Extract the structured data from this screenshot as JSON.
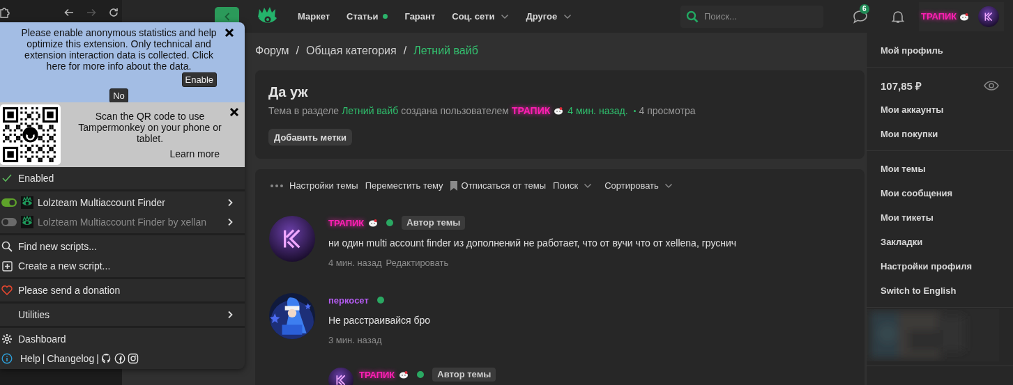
{
  "browser_toolbar": {
    "buttons": [
      {
        "kind": "extensions",
        "disabled": false
      },
      {
        "kind": "back",
        "disabled": false
      },
      {
        "kind": "forward",
        "disabled": true
      },
      {
        "kind": "reload",
        "disabled": false
      }
    ]
  },
  "tampermonkey": {
    "notice": {
      "text": "Please enable anonymous statistics and help optimize this extension. Only technical and extension interaction data is collected. Click here for more info about the data.",
      "enable_button": "Enable",
      "no_button": "No"
    },
    "qr": {
      "text": "Scan the QR code to use Tampermonkey on your phone or tablet.",
      "link": "Learn more"
    },
    "enabled": {
      "label": "Enabled",
      "checked": true
    },
    "scripts": [
      {
        "name": "Lolzteam Multiaccount Finder",
        "on": true
      },
      {
        "name": "Lolzteam Multiaccount Finder by xellan",
        "on": false
      }
    ],
    "menu_groups": [
      {
        "items": [
          {
            "kind": "find",
            "label": "Find new scripts..."
          },
          {
            "kind": "create",
            "label": "Create a new script..."
          }
        ]
      },
      {
        "items": [
          {
            "kind": "donate",
            "label": "Please send a donation"
          }
        ]
      },
      {
        "items": [
          {
            "kind": "submenu",
            "label": "Utilities"
          }
        ]
      },
      {
        "items": [
          {
            "kind": "dashboard",
            "label": "Dashboard"
          }
        ]
      }
    ],
    "footer": [
      {
        "kind": "link",
        "label": "Help"
      },
      {
        "kind": "text",
        "label": "|"
      },
      {
        "kind": "link",
        "label": "Changelog"
      },
      {
        "kind": "text",
        "label": "|"
      },
      {
        "kind": "github"
      },
      {
        "kind": "facebook"
      },
      {
        "kind": "instagram"
      }
    ]
  },
  "site": {
    "header": {
      "nav": [
        {
          "label": "Маркет",
          "dot": false,
          "dropdown": false
        },
        {
          "label": "Статьи",
          "dot": true,
          "dropdown": false
        },
        {
          "label": "Гарант",
          "dot": false,
          "dropdown": false
        },
        {
          "label": "Соц. сети",
          "dot": false,
          "dropdown": true
        },
        {
          "label": "Другое",
          "dot": false,
          "dropdown": true
        }
      ],
      "search": {
        "placeholder": "Поиск..."
      },
      "messages": {
        "count": "6"
      },
      "user": {
        "name": "ТРАПИК"
      }
    },
    "breadcrumb": [
      {
        "label": "Форум",
        "selected": false
      },
      {
        "label": "Общая категория",
        "prefix": "/",
        "selected": false
      },
      {
        "label": "Летний вайб",
        "prefix": "/",
        "selected": true
      }
    ],
    "thread": {
      "title": "Да уж",
      "meta": {
        "lead": "Тема в разделе",
        "section": "Летний вайб",
        "middle": "создана пользователем",
        "author": "ТРАПИК",
        "time": "4 мин. назад.",
        "views": "4 просмотра"
      },
      "add_tags": "Добавить метки",
      "toolbar": [
        {
          "kind": "menu",
          "label": "Настройки темы"
        },
        {
          "kind": "plain",
          "label": "Переместить тему"
        },
        {
          "kind": "bookmark",
          "label": "Отписаться от темы"
        },
        {
          "kind": "dropdown",
          "label": "Поиск"
        },
        {
          "kind": "dropdown",
          "label": "Сортировать"
        }
      ],
      "posts": [
        {
          "author": "ТРАПИК",
          "color": "#ff1fb4",
          "glow": true,
          "sticker": true,
          "online": true,
          "badge": "Автор темы",
          "avatar": {
            "kind": "logo"
          },
          "text": "ни один multi account finder из дополнений не работает, что от вучи что от xellena, груснич",
          "time": "4 мин. назад",
          "actions": [
            "Редактировать"
          ]
        },
        {
          "author": "перкосет",
          "color": "#b45cf0",
          "glow": false,
          "sticker": false,
          "online": true,
          "avatar": {
            "kind": "picture"
          },
          "text": "Не расстраивайся бро",
          "time": "3 мин. назад",
          "children": [
            {
              "author": "ТРАПИК",
              "color": "#ff1fb4",
              "glow": true,
              "sticker": true,
              "online": true,
              "badge": "Автор темы",
              "avatar": {
                "kind": "logo"
              }
            }
          ]
        }
      ]
    }
  },
  "user_menu": {
    "sections": [
      {
        "items": [
          {
            "kind": "link",
            "label": "Мой профиль"
          }
        ]
      },
      {
        "items": [
          {
            "kind": "balance",
            "label": "107,85 ₽"
          },
          {
            "kind": "link",
            "label": "Мои аккаунты"
          },
          {
            "kind": "link",
            "label": "Мои покупки"
          }
        ]
      },
      {
        "items": [
          {
            "kind": "link",
            "label": "Мои темы"
          },
          {
            "kind": "link",
            "label": "Мои сообщения"
          },
          {
            "kind": "link",
            "label": "Мои тикеты"
          },
          {
            "kind": "link",
            "label": "Закладки"
          },
          {
            "kind": "link",
            "label": "Настройки профиля"
          },
          {
            "kind": "link",
            "label": "Switch to English"
          }
        ]
      },
      {
        "items": [
          {
            "kind": "picture"
          }
        ]
      }
    ]
  }
}
